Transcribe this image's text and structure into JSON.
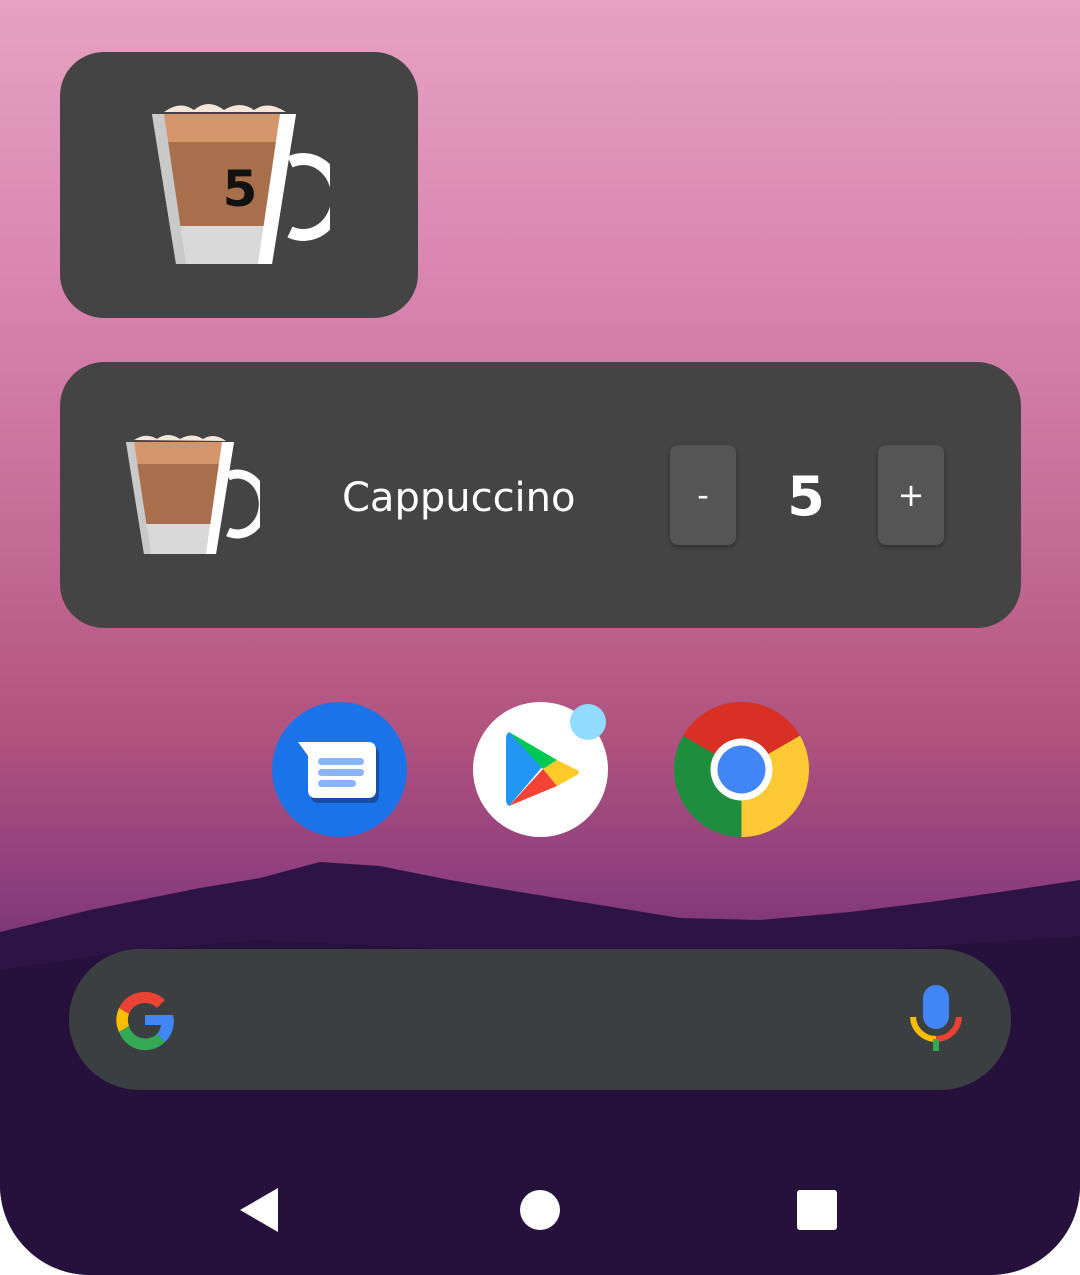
{
  "widgets": {
    "small": {
      "count": "5",
      "icon": "cappuccino-cup-icon"
    },
    "large": {
      "name": "Cappuccino",
      "decrement_label": "-",
      "increment_label": "+",
      "count": "5",
      "icon": "cappuccino-cup-icon"
    }
  },
  "dock_apps": [
    {
      "icon": "messages-app-icon",
      "color": "#1a73e8"
    },
    {
      "icon": "play-store-app-icon",
      "color": "#ffffff",
      "badge_color": "#8fdcff"
    },
    {
      "icon": "chrome-app-icon",
      "color": "#db4437"
    }
  ],
  "search": {
    "logo": "google-g-icon",
    "mic": "microphone-icon",
    "bar_color": "#3c3f41"
  },
  "nav": [
    "back-icon",
    "home-icon",
    "recents-icon"
  ],
  "colors": {
    "widget_bg": "#444444",
    "button_bg": "#555555"
  }
}
